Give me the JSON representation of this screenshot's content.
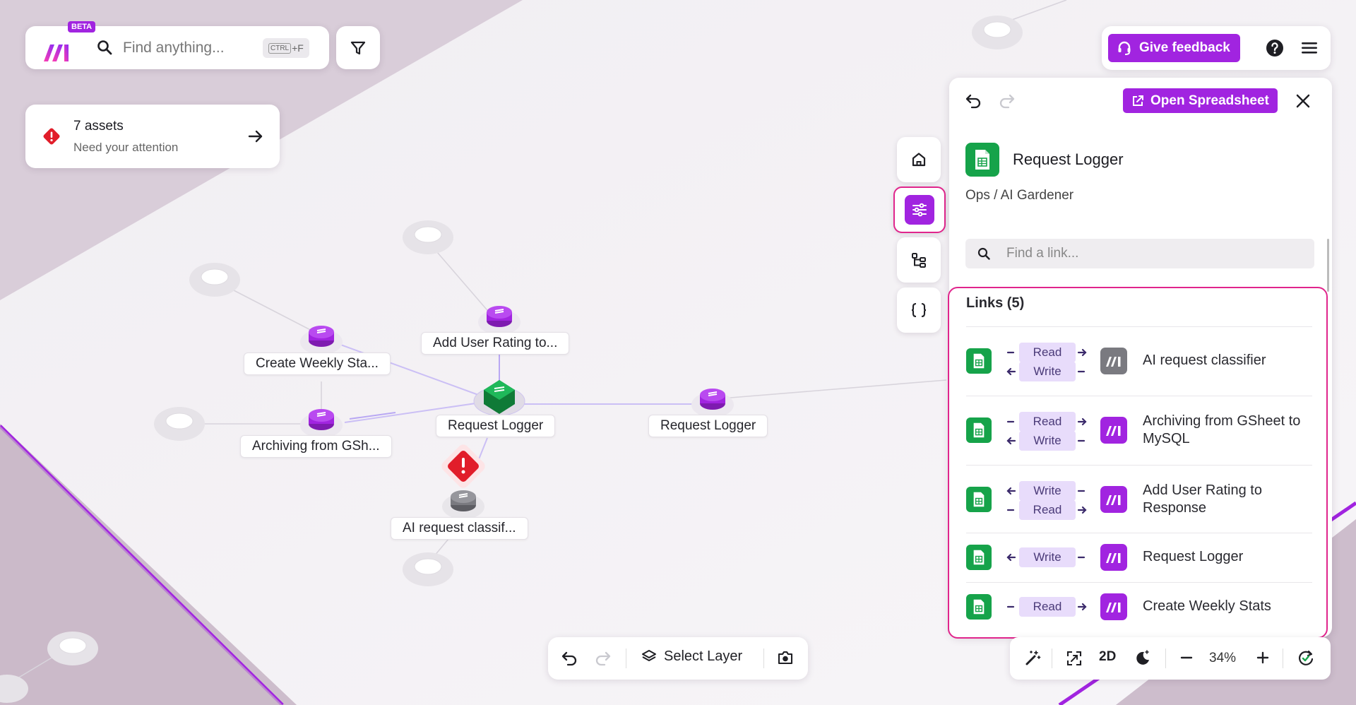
{
  "search": {
    "placeholder": "Find anything...",
    "shortcut_key": "CTRL",
    "shortcut_suffix": "+F"
  },
  "brand": {
    "badge": "BETA"
  },
  "attention": {
    "title": "7 assets",
    "subtitle": "Need your attention"
  },
  "header": {
    "feedback_label": "Give feedback"
  },
  "graph": {
    "nodes": [
      {
        "label": "Add User Rating to..."
      },
      {
        "label": "Create Weekly Sta..."
      },
      {
        "label": "Request Logger"
      },
      {
        "label": "Request Logger"
      },
      {
        "label": "Archiving from GSh..."
      },
      {
        "label": "AI request classif..."
      }
    ]
  },
  "panel": {
    "open_label": "Open Spreadsheet",
    "title": "Request Logger",
    "breadcrumb": "Ops / AI Gardener",
    "link_search_placeholder": "Find a link...",
    "links_title": "Links (5)",
    "links": [
      {
        "name": "AI request classifier",
        "labels": [
          "Read",
          "Write"
        ],
        "app_color": "#7a7a80"
      },
      {
        "name": "Archiving from GSheet to MySQL",
        "labels": [
          "Read",
          "Write"
        ],
        "app_color": "#a124e0"
      },
      {
        "name": "Add User Rating to Response",
        "labels": [
          "Write",
          "Read"
        ],
        "app_color": "#a124e0"
      },
      {
        "name": "Request Logger",
        "labels": [
          "Write"
        ],
        "app_color": "#a124e0"
      },
      {
        "name": "Create Weekly Stats",
        "labels": [
          "Read"
        ],
        "app_color": "#a124e0"
      }
    ]
  },
  "toolbar": {
    "select_layer_label": "Select Layer"
  },
  "view": {
    "mode_label": "2D",
    "zoom": "34%"
  },
  "colors": {
    "accent": "#a124e0",
    "highlight": "#e0258c",
    "sheets_green": "#16a34a",
    "warning_red": "#e11d2a"
  }
}
